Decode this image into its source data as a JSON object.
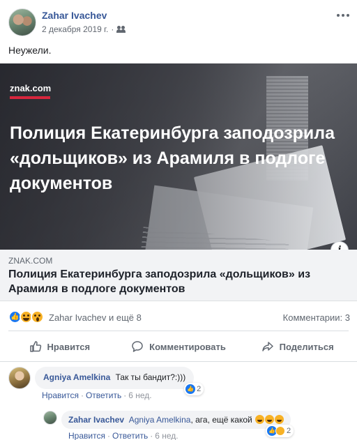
{
  "post": {
    "author": "Zahar Ivachev",
    "date": "2 декабря 2019 г.",
    "separator": "·",
    "privacy_icon": "friends-icon",
    "text": "Неужели."
  },
  "link_preview": {
    "logo_text": "znak.com",
    "image_headline": "Полиция Екатеринбурга заподозрила «дольщиков» из Арамиля в подлоге документов",
    "domain": "ZNAK.COM",
    "title": "Полиция Екатеринбурга заподозрила «дольщиков» из Арамиля в подлоге документов",
    "info_label": "i"
  },
  "reactions": {
    "icons": [
      "like-icon",
      "haha-icon",
      "wow-icon"
    ],
    "names": "Zahar Ivachev и ещё 8",
    "comments_count": "Комментарии: 3"
  },
  "actions": {
    "like": "Нравится",
    "comment": "Комментировать",
    "share": "Поделиться"
  },
  "comments": [
    {
      "author": "Agniya Amelkina",
      "text": "Так ты бандит?:)))",
      "reaction_count": "2",
      "like_label": "Нравится",
      "reply_label": "Ответить",
      "time": "6 нед."
    },
    {
      "author": "Zahar Ivachev",
      "mention": "Agniya Amelkina",
      "text": ", ага, ещё какой",
      "reaction_count": "2",
      "like_label": "Нравится",
      "reply_label": "Ответить",
      "time": "6 нед."
    }
  ],
  "colors": {
    "link_blue": "#385898",
    "secondary_text": "#606770",
    "znak_red": "#d7263d",
    "like_blue": "#1877f2",
    "emoji_yellow": "#f7b125"
  }
}
